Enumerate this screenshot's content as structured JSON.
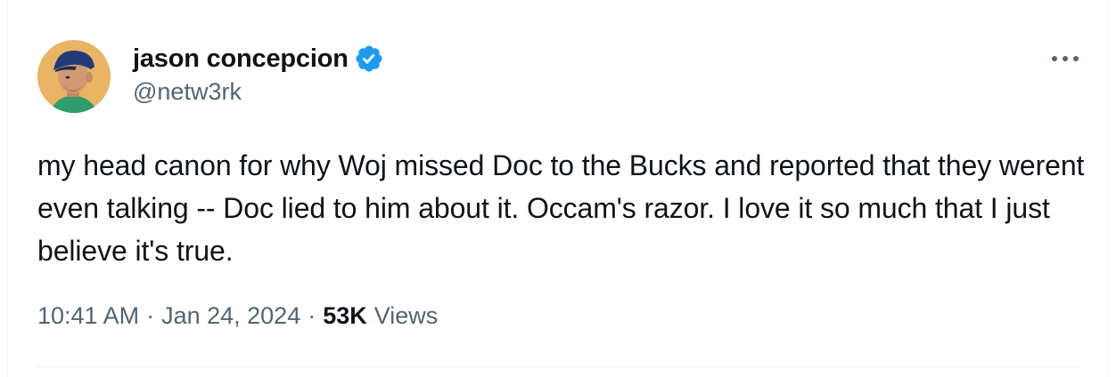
{
  "author": {
    "display_name": "jason concepcion",
    "handle": "@netw3rk",
    "verified": true
  },
  "tweet": {
    "text": "my head canon for why Woj missed Doc to the Bucks and reported that they werent even talking -- Doc lied to him about it. Occam's razor. I love it so much that I just believe it's true.",
    "time": "10:41 AM",
    "separator": "·",
    "date": "Jan 24, 2024",
    "views_count": "53K",
    "views_label": "Views"
  },
  "icons": {
    "verified": "verified-badge-icon",
    "more": "more-options-icon"
  },
  "colors": {
    "verified_blue": "#1d9bf0",
    "secondary_text": "#536471",
    "primary_text": "#0f1419"
  }
}
